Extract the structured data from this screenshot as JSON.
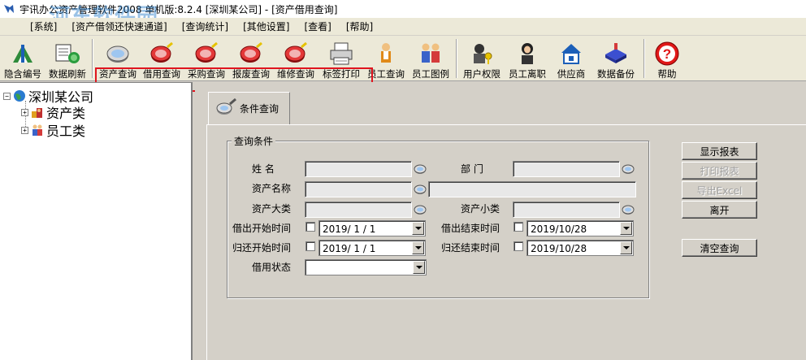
{
  "window": {
    "title": "宇讯办公资产管理软件2008 单机版:8.2.4  [深圳某公司] - [资产借用查询]",
    "watermark": "河东软件园",
    "watermark_url": "www.pc0359.cn"
  },
  "menu": [
    "[系统]",
    "[资产借领还快速通道]",
    "[查询统计]",
    "[其他设置]",
    "[查看]",
    "[帮助]"
  ],
  "toolbar": {
    "buttons": [
      {
        "label": "隐含编号",
        "icon": "hide-number-icon"
      },
      {
        "label": "数据刷新",
        "icon": "refresh-icon"
      },
      {
        "label": "资产查询",
        "icon": "asset-query-icon"
      },
      {
        "label": "借用查询",
        "icon": "borrow-query-icon"
      },
      {
        "label": "采购查询",
        "icon": "purchase-query-icon"
      },
      {
        "label": "报废查询",
        "icon": "scrap-query-icon"
      },
      {
        "label": "维修查询",
        "icon": "repair-query-icon"
      },
      {
        "label": "标签打印",
        "icon": "printer-icon"
      },
      {
        "label": "员工查询",
        "icon": "employee-query-icon"
      },
      {
        "label": "员工图例",
        "icon": "employee-legend-icon"
      },
      {
        "label": "用户权限",
        "icon": "user-permission-icon"
      },
      {
        "label": "员工离职",
        "icon": "employee-leave-icon"
      },
      {
        "label": "供应商",
        "icon": "supplier-icon"
      },
      {
        "label": "数据备份",
        "icon": "backup-icon"
      },
      {
        "label": "帮助",
        "icon": "help-icon"
      }
    ]
  },
  "tree": {
    "root": "深圳某公司",
    "children": [
      "资产类",
      "员工类"
    ]
  },
  "tab": {
    "label": "条件查询"
  },
  "form": {
    "group_title": "查询条件",
    "name_label": "姓  名",
    "dept_label": "部  门",
    "asset_name_label": "资产名称",
    "asset_major_label": "资产大类",
    "asset_minor_label": "资产小类",
    "borrow_start_label": "借出开始时间",
    "borrow_end_label": "借出结束时间",
    "return_start_label": "归还开始时间",
    "return_end_label": "归还结束时间",
    "status_label": "借用状态",
    "borrow_start_value": "2019/ 1 / 1",
    "borrow_end_value": "2019/10/28",
    "return_start_value": "2019/ 1 / 1",
    "return_end_value": "2019/10/28",
    "status_value": ""
  },
  "buttons": {
    "show_report": "显示报表",
    "print_report": "打印报表",
    "export_excel": "导出Excel",
    "leave": "离开",
    "clear_query": "清空查询"
  },
  "colors": {
    "highlight": "#e0141e",
    "window_bg": "#d4d0c8"
  }
}
